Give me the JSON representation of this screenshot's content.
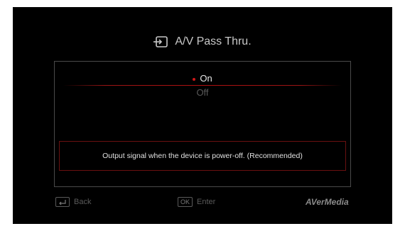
{
  "title": {
    "icon": "input-source-icon",
    "text": "A/V Pass Thru."
  },
  "options": [
    {
      "label": "On",
      "selected": true
    },
    {
      "label": "Off",
      "selected": false
    }
  ],
  "description": "Output signal when the device is power-off. (Recommended)",
  "footer": {
    "back": {
      "key": "↵",
      "label": "Back"
    },
    "enter": {
      "key": "OK",
      "label": "Enter"
    }
  },
  "brand": "AVerMedia",
  "colors": {
    "accent": "#d01818",
    "background": "#000000",
    "text": "#e6e6e6",
    "dim": "#5a5a5a"
  }
}
